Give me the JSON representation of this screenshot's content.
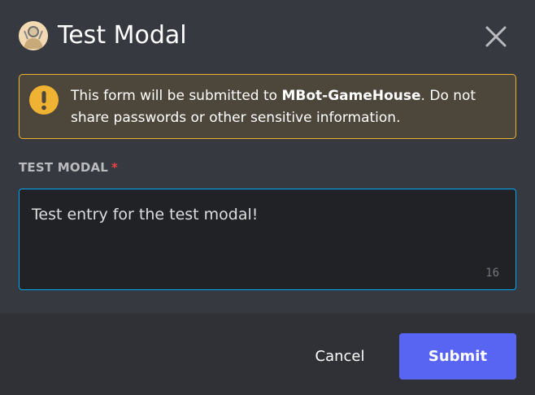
{
  "modal": {
    "title": "Test Modal",
    "avatar_icon": "bot-avatar-icon",
    "close_icon": "close-icon"
  },
  "warning": {
    "icon": "exclamation-icon",
    "text_before": "This form will be submitted to ",
    "bot_name": "MBot-GameHouse",
    "text_after": ". Do not share passwords or other sensitive information.",
    "color_border": "#f0b232"
  },
  "field": {
    "label": "TEST MODAL",
    "required_marker": "*",
    "value": "Test entry for the test modal!",
    "char_count": "16"
  },
  "footer": {
    "cancel_label": "Cancel",
    "submit_label": "Submit"
  },
  "colors": {
    "accent": "#5865f2",
    "focus": "#00a8fc",
    "required": "#ed4245",
    "background": "#36393f",
    "footer": "#2f3136"
  }
}
